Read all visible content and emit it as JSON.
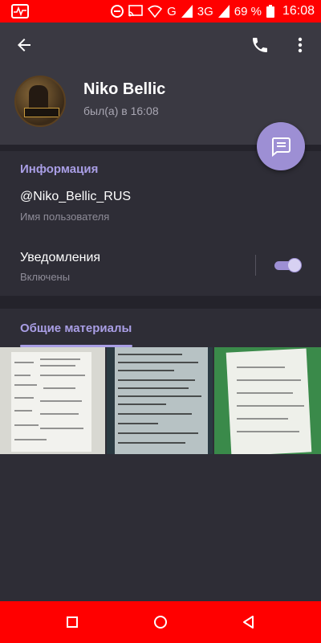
{
  "status_bar": {
    "battery": "69 %",
    "network": "3G",
    "time": "16:08"
  },
  "header": {
    "name": "Niko Bellic",
    "last_seen": "был(а) в 16:08"
  },
  "info": {
    "section_title": "Информация",
    "username": "@Niko_Bellic_RUS",
    "username_label": "Имя пользователя",
    "notifications": "Уведомления",
    "notifications_state": "Включены",
    "notifications_enabled": true
  },
  "media": {
    "section_title": "Общие материалы"
  },
  "colors": {
    "status_bar": "#ff0000",
    "accent": "#a99ee5",
    "fab": "#9d8fd4",
    "background": "#2b2a33"
  }
}
